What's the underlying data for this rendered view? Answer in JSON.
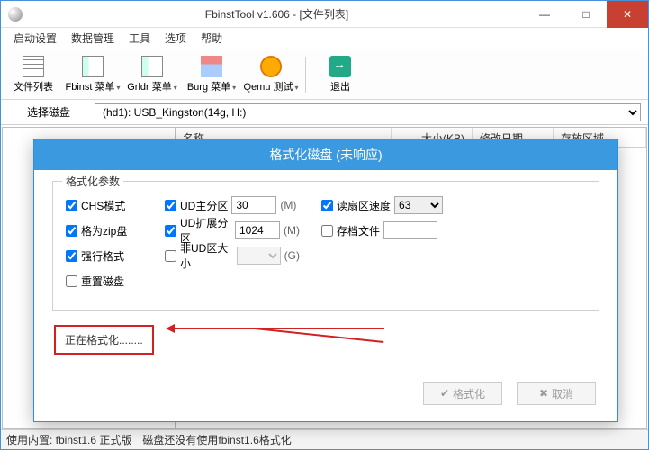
{
  "window": {
    "title": "FbinstTool v1.606 - [文件列表]",
    "min": "—",
    "max": "□",
    "close": "✕"
  },
  "menubar": {
    "items": [
      "启动设置",
      "数据管理",
      "工具",
      "选项",
      "帮助"
    ]
  },
  "toolbar": {
    "file_list": "文件列表",
    "fbinst_menu": "Fbinst 菜单",
    "grldr_menu": "Grldr 菜单",
    "burg_menu": "Burg 菜单",
    "qemu_test": "Qemu 测试",
    "exit": "退出"
  },
  "disk_selector": {
    "label": "选择磁盘",
    "value": "(hd1): USB_Kingston(14g, H:)"
  },
  "columns": {
    "name": "名称",
    "size_kb": "大小(KB)",
    "mod_date": "修改日期",
    "area": "存放区域"
  },
  "modal": {
    "title": "格式化磁盘 (未响应)",
    "group_legend": "格式化参数",
    "chs_mode": {
      "label": "CHS模式",
      "checked": true
    },
    "zip_format": {
      "label": "格为zip盘",
      "checked": true
    },
    "force_format": {
      "label": "强行格式",
      "checked": true
    },
    "reset_disk": {
      "label": "重置磁盘",
      "checked": false
    },
    "ud_primary": {
      "label": "UD主分区",
      "checked": true,
      "value": "30",
      "unit": "(M)"
    },
    "ud_extended": {
      "label": "UD扩展分区",
      "checked": true,
      "value": "1024",
      "unit": "(M)"
    },
    "non_ud_size": {
      "label": "非UD区大小",
      "checked": false,
      "value": "",
      "unit": "(G)"
    },
    "read_sector_speed": {
      "label": "读扇区速度",
      "checked": true,
      "value": "63"
    },
    "archive_file": {
      "label": "存档文件",
      "checked": false,
      "value": ""
    },
    "status_text": "正在格式化........",
    "btn_format": "格式化",
    "btn_cancel": "取消"
  },
  "status": {
    "left": "使用内置: fbinst1.6 正式版",
    "right": "磁盘还没有使用fbinst1.6格式化"
  }
}
